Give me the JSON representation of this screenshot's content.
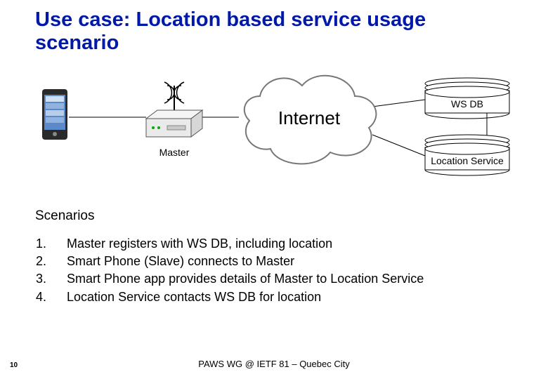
{
  "title": "Use case: Location based service usage scenario",
  "diagram": {
    "phone_label": "",
    "master_label": "Master",
    "cloud_label": "Internet",
    "db1_label": "WS DB",
    "db2_label": "Location Service"
  },
  "scenarios_heading": "Scenarios",
  "scenarios": [
    {
      "n": "1.",
      "text": "Master registers with WS DB, including location"
    },
    {
      "n": "2.",
      "text": "Smart Phone (Slave) connects to Master"
    },
    {
      "n": "3.",
      "text": "Smart Phone app provides details of Master to Location Service"
    },
    {
      "n": "4.",
      "text": "Location Service contacts WS DB for location"
    }
  ],
  "footer": "PAWS WG @ IETF 81 – Quebec City",
  "page_number": "10"
}
